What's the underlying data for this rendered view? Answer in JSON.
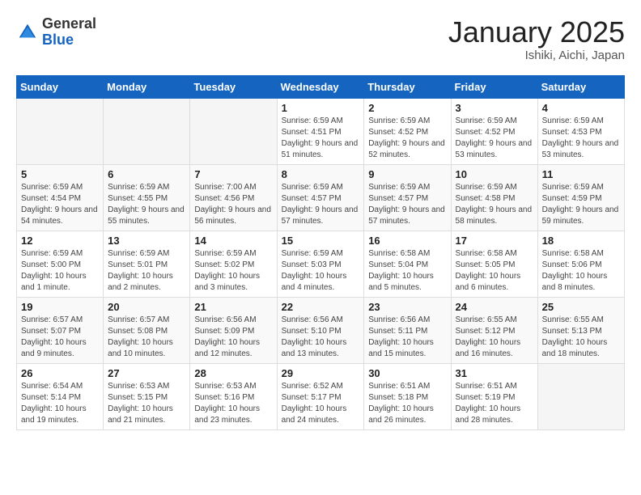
{
  "header": {
    "logo_general": "General",
    "logo_blue": "Blue",
    "month_title": "January 2025",
    "location": "Ishiki, Aichi, Japan"
  },
  "days_of_week": [
    "Sunday",
    "Monday",
    "Tuesday",
    "Wednesday",
    "Thursday",
    "Friday",
    "Saturday"
  ],
  "weeks": [
    [
      {
        "day": "",
        "info": ""
      },
      {
        "day": "",
        "info": ""
      },
      {
        "day": "",
        "info": ""
      },
      {
        "day": "1",
        "info": "Sunrise: 6:59 AM\nSunset: 4:51 PM\nDaylight: 9 hours\nand 51 minutes."
      },
      {
        "day": "2",
        "info": "Sunrise: 6:59 AM\nSunset: 4:52 PM\nDaylight: 9 hours\nand 52 minutes."
      },
      {
        "day": "3",
        "info": "Sunrise: 6:59 AM\nSunset: 4:52 PM\nDaylight: 9 hours\nand 53 minutes."
      },
      {
        "day": "4",
        "info": "Sunrise: 6:59 AM\nSunset: 4:53 PM\nDaylight: 9 hours\nand 53 minutes."
      }
    ],
    [
      {
        "day": "5",
        "info": "Sunrise: 6:59 AM\nSunset: 4:54 PM\nDaylight: 9 hours\nand 54 minutes."
      },
      {
        "day": "6",
        "info": "Sunrise: 6:59 AM\nSunset: 4:55 PM\nDaylight: 9 hours\nand 55 minutes."
      },
      {
        "day": "7",
        "info": "Sunrise: 7:00 AM\nSunset: 4:56 PM\nDaylight: 9 hours\nand 56 minutes."
      },
      {
        "day": "8",
        "info": "Sunrise: 6:59 AM\nSunset: 4:57 PM\nDaylight: 9 hours\nand 57 minutes."
      },
      {
        "day": "9",
        "info": "Sunrise: 6:59 AM\nSunset: 4:57 PM\nDaylight: 9 hours\nand 57 minutes."
      },
      {
        "day": "10",
        "info": "Sunrise: 6:59 AM\nSunset: 4:58 PM\nDaylight: 9 hours\nand 58 minutes."
      },
      {
        "day": "11",
        "info": "Sunrise: 6:59 AM\nSunset: 4:59 PM\nDaylight: 9 hours\nand 59 minutes."
      }
    ],
    [
      {
        "day": "12",
        "info": "Sunrise: 6:59 AM\nSunset: 5:00 PM\nDaylight: 10 hours\nand 1 minute."
      },
      {
        "day": "13",
        "info": "Sunrise: 6:59 AM\nSunset: 5:01 PM\nDaylight: 10 hours\nand 2 minutes."
      },
      {
        "day": "14",
        "info": "Sunrise: 6:59 AM\nSunset: 5:02 PM\nDaylight: 10 hours\nand 3 minutes."
      },
      {
        "day": "15",
        "info": "Sunrise: 6:59 AM\nSunset: 5:03 PM\nDaylight: 10 hours\nand 4 minutes."
      },
      {
        "day": "16",
        "info": "Sunrise: 6:58 AM\nSunset: 5:04 PM\nDaylight: 10 hours\nand 5 minutes."
      },
      {
        "day": "17",
        "info": "Sunrise: 6:58 AM\nSunset: 5:05 PM\nDaylight: 10 hours\nand 6 minutes."
      },
      {
        "day": "18",
        "info": "Sunrise: 6:58 AM\nSunset: 5:06 PM\nDaylight: 10 hours\nand 8 minutes."
      }
    ],
    [
      {
        "day": "19",
        "info": "Sunrise: 6:57 AM\nSunset: 5:07 PM\nDaylight: 10 hours\nand 9 minutes."
      },
      {
        "day": "20",
        "info": "Sunrise: 6:57 AM\nSunset: 5:08 PM\nDaylight: 10 hours\nand 10 minutes."
      },
      {
        "day": "21",
        "info": "Sunrise: 6:56 AM\nSunset: 5:09 PM\nDaylight: 10 hours\nand 12 minutes."
      },
      {
        "day": "22",
        "info": "Sunrise: 6:56 AM\nSunset: 5:10 PM\nDaylight: 10 hours\nand 13 minutes."
      },
      {
        "day": "23",
        "info": "Sunrise: 6:56 AM\nSunset: 5:11 PM\nDaylight: 10 hours\nand 15 minutes."
      },
      {
        "day": "24",
        "info": "Sunrise: 6:55 AM\nSunset: 5:12 PM\nDaylight: 10 hours\nand 16 minutes."
      },
      {
        "day": "25",
        "info": "Sunrise: 6:55 AM\nSunset: 5:13 PM\nDaylight: 10 hours\nand 18 minutes."
      }
    ],
    [
      {
        "day": "26",
        "info": "Sunrise: 6:54 AM\nSunset: 5:14 PM\nDaylight: 10 hours\nand 19 minutes."
      },
      {
        "day": "27",
        "info": "Sunrise: 6:53 AM\nSunset: 5:15 PM\nDaylight: 10 hours\nand 21 minutes."
      },
      {
        "day": "28",
        "info": "Sunrise: 6:53 AM\nSunset: 5:16 PM\nDaylight: 10 hours\nand 23 minutes."
      },
      {
        "day": "29",
        "info": "Sunrise: 6:52 AM\nSunset: 5:17 PM\nDaylight: 10 hours\nand 24 minutes."
      },
      {
        "day": "30",
        "info": "Sunrise: 6:51 AM\nSunset: 5:18 PM\nDaylight: 10 hours\nand 26 minutes."
      },
      {
        "day": "31",
        "info": "Sunrise: 6:51 AM\nSunset: 5:19 PM\nDaylight: 10 hours\nand 28 minutes."
      },
      {
        "day": "",
        "info": ""
      }
    ]
  ]
}
